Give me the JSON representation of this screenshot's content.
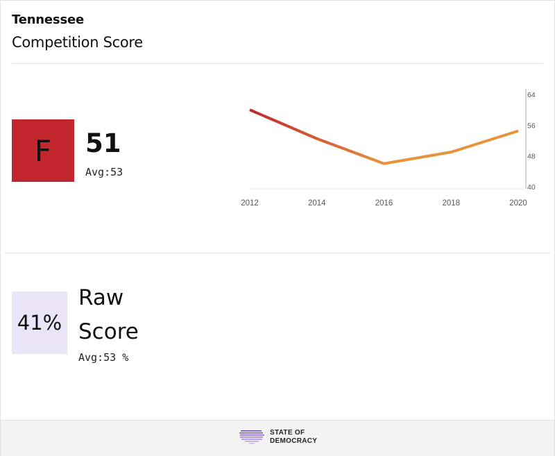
{
  "header": {
    "state": "Tennessee",
    "metric": "Competition Score"
  },
  "score": {
    "grade": "F",
    "grade_color": "#c1272d",
    "value": "51",
    "average": "Avg:53"
  },
  "raw": {
    "value": "41%",
    "label": "Raw Score",
    "average": "Avg:53 %",
    "box_color": "#ebe4f8"
  },
  "footer": {
    "logo_icon": "us-map-logo-icon",
    "logo_line1": "STATE OF",
    "logo_line2": "DEMOCRACY"
  },
  "chart_data": {
    "type": "line",
    "x": [
      2012,
      2014,
      2016,
      2018,
      2020
    ],
    "series": [
      {
        "values": [
          60,
          52.5,
          46,
          49,
          54.5
        ]
      }
    ],
    "x_ticks": [
      "2012",
      "2014",
      "2016",
      "2018",
      "2020"
    ],
    "y_ticks": [
      "64",
      "56",
      "48",
      "40"
    ],
    "ylim": [
      40,
      64
    ],
    "y_axis_position": "right",
    "gradient_colors": [
      "#c1272d",
      "#e8923a"
    ],
    "grid": false
  }
}
